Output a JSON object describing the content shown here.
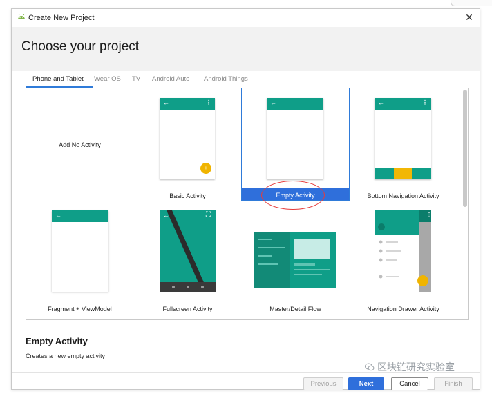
{
  "window": {
    "title": "Create New Project",
    "close_glyph": "✕"
  },
  "header": {
    "heading": "Choose your project"
  },
  "tabs": [
    {
      "label": "Phone and Tablet",
      "active": true
    },
    {
      "label": "Wear OS",
      "active": false
    },
    {
      "label": "TV",
      "active": false
    },
    {
      "label": "Android Auto",
      "active": false
    },
    {
      "label": "Android Things",
      "active": false
    }
  ],
  "templates": [
    {
      "label": "Add No Activity"
    },
    {
      "label": "Basic Activity"
    },
    {
      "label": "Empty Activity",
      "selected": true
    },
    {
      "label": "Bottom Navigation Activity"
    },
    {
      "label": "Fragment + ViewModel"
    },
    {
      "label": "Fullscreen Activity"
    },
    {
      "label": "Master/Detail Flow"
    },
    {
      "label": "Navigation Drawer Activity"
    }
  ],
  "preview_glyphs": {
    "back": "←",
    "menu": "⋮",
    "expand": "⛶"
  },
  "selection": {
    "title": "Empty Activity",
    "description": "Creates a new empty activity"
  },
  "buttons": {
    "previous": "Previous",
    "next": "Next",
    "cancel": "Cancel",
    "finish": "Finish"
  },
  "watermark": {
    "text": "区块链研究实验室",
    "icon": "wechat-icon"
  },
  "colors": {
    "teal": "#0f9e88",
    "accent_blue": "#2f6fdb",
    "fab_yellow": "#f0b400",
    "annotation_red": "#e63b3b"
  }
}
